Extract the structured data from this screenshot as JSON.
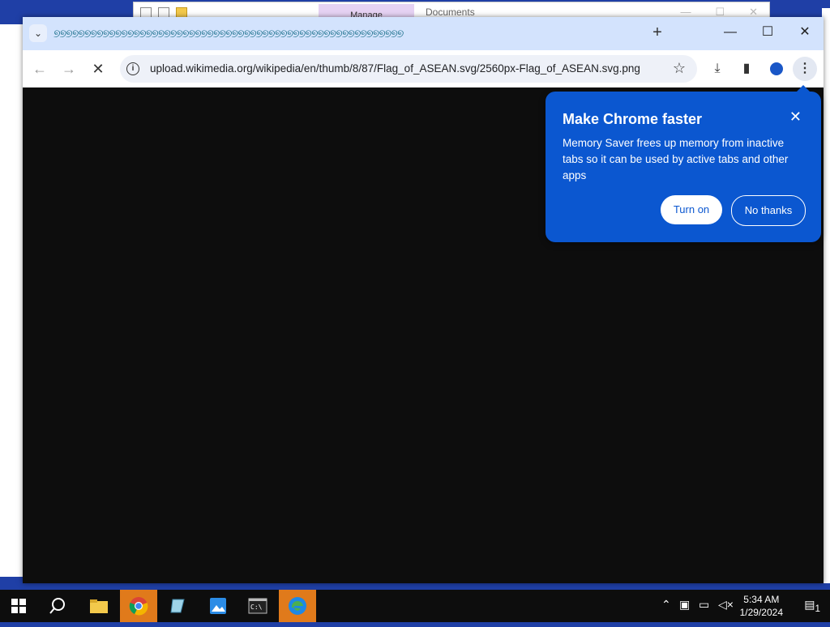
{
  "background_window": {
    "manage_label": "Manage",
    "documents_label": "Documents"
  },
  "browser": {
    "tab_strip_text": "୭୭୭୭୭୭୭୭୭୭୭୭୭୭୭୭୭୭୭୭୭୭୭୭୭୭୭୭୭୭୭୭୭୭୭୭୭୭୭୭୭୭୭୭୭୭୭୭୭୭୭୭୭୭୭୭୭",
    "new_tab_symbol": "+",
    "minimize_symbol": "—",
    "maximize_symbol": "☐",
    "close_symbol": "✕",
    "back_symbol": "←",
    "forward_symbol": "→",
    "reload_symbol": "✕",
    "url": "upload.wikimedia.org/wikipedia/en/thumb/8/87/Flag_of_ASEAN.svg/2560px-Flag_of_ASEAN.svg.png",
    "star_symbol": "☆",
    "download_symbol": "⤓",
    "sidepanel_symbol": "▮",
    "menu_symbol": "⋮"
  },
  "popup": {
    "title": "Make Chrome faster",
    "body": "Memory Saver frees up memory from inactive tabs so it can be used by active tabs and other apps",
    "turn_on_label": "Turn on",
    "no_thanks_label": "No thanks",
    "close_symbol": "✕"
  },
  "taskbar": {
    "time": "5:34 AM",
    "date": "1/29/2024",
    "notification_count": "1"
  },
  "colors": {
    "accent": "#0b57d0",
    "titlebar": "#d3e3fd",
    "taskbar_active": "#e07a1b"
  }
}
